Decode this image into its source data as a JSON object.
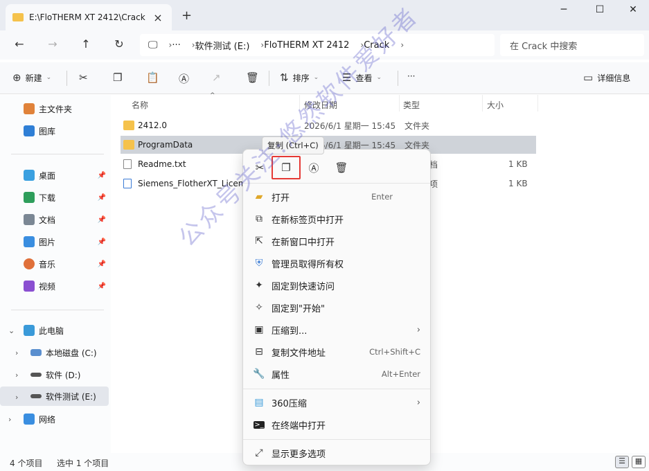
{
  "window": {
    "tab_title": "E:\\FloTHERM XT 2412\\Crack",
    "new_tab": "+",
    "minimize": "─",
    "maximize": "☐",
    "close": "✕"
  },
  "nav": {
    "back": "←",
    "forward": "→",
    "up": "↑",
    "refresh": "↻",
    "breadcrumbs": [
      "软件测试 (E:)",
      "FloTHERM XT 2412",
      "Crack"
    ],
    "overflow": "···",
    "search_placeholder": "在 Crack 中搜索"
  },
  "toolbar": {
    "new_label": "新建",
    "sort_label": "排序",
    "view_label": "查看",
    "more": "···",
    "details_label": "详细信息"
  },
  "sidebar": {
    "quick": [
      {
        "label": "主文件夹",
        "color": "#e0823a"
      },
      {
        "label": "图库",
        "color": "#2f7fd6"
      }
    ],
    "pinned": [
      {
        "label": "桌面",
        "color": "#3aa0e0"
      },
      {
        "label": "下载",
        "color": "#2e9e5b"
      },
      {
        "label": "文档",
        "color": "#7b8794"
      },
      {
        "label": "图片",
        "color": "#3a8ee0"
      },
      {
        "label": "音乐",
        "color": "#e0703a"
      },
      {
        "label": "视频",
        "color": "#8a4fd1"
      }
    ],
    "this_pc": "此电脑",
    "drives": [
      "本地磁盘 (C:)",
      "软件 (D:)",
      "软件测试 (E:)"
    ],
    "network": "网络"
  },
  "columns": {
    "name": "名称",
    "date": "修改日期",
    "type": "类型",
    "size": "大小"
  },
  "files": [
    {
      "name": "2412.0",
      "date": "2026/6/1 星期一 15:45",
      "type": "文件夹",
      "size": "",
      "kind": "folder"
    },
    {
      "name": "ProgramData",
      "date": "2026/6/1 星期一 15:45",
      "type": "文件夹",
      "size": "",
      "kind": "folder"
    },
    {
      "name": "Readme.txt",
      "date": "",
      "type": "文本文档",
      "size": "1 KB",
      "kind": "doc"
    },
    {
      "name": "Siemens_FlotherXT_Licensi",
      "date": "",
      "type": "注册表项",
      "size": "1 KB",
      "kind": "doc"
    }
  ],
  "status": {
    "count": "4 个项目",
    "selected": "选中 1 个项目"
  },
  "tooltip": "复制 (Ctrl+C)",
  "context_menu": {
    "items": [
      {
        "label": "打开",
        "shortcut": "Enter",
        "icon": "folder-open-icon"
      },
      {
        "label": "在新标签页中打开",
        "shortcut": "",
        "icon": "new-tab-icon"
      },
      {
        "label": "在新窗口中打开",
        "shortcut": "",
        "icon": "new-window-icon"
      },
      {
        "label": "管理员取得所有权",
        "shortcut": "",
        "icon": "shield-icon"
      },
      {
        "label": "固定到快速访问",
        "shortcut": "",
        "icon": "pin-icon"
      },
      {
        "label": "固定到\"开始\"",
        "shortcut": "",
        "icon": "pin-icon"
      },
      {
        "label": "压缩到...",
        "shortcut": "",
        "icon": "zip-icon"
      },
      {
        "label": "复制文件地址",
        "shortcut": "Ctrl+Shift+C",
        "icon": "copy-path-icon"
      },
      {
        "label": "属性",
        "shortcut": "Alt+Enter",
        "icon": "wrench-icon"
      }
    ],
    "extra": [
      {
        "label": "360压缩",
        "icon": "archive-icon"
      },
      {
        "label": "在终端中打开",
        "icon": "terminal-icon"
      }
    ],
    "more": "显示更多选项"
  },
  "watermark": "公众号关注:悠然软件爱好者"
}
